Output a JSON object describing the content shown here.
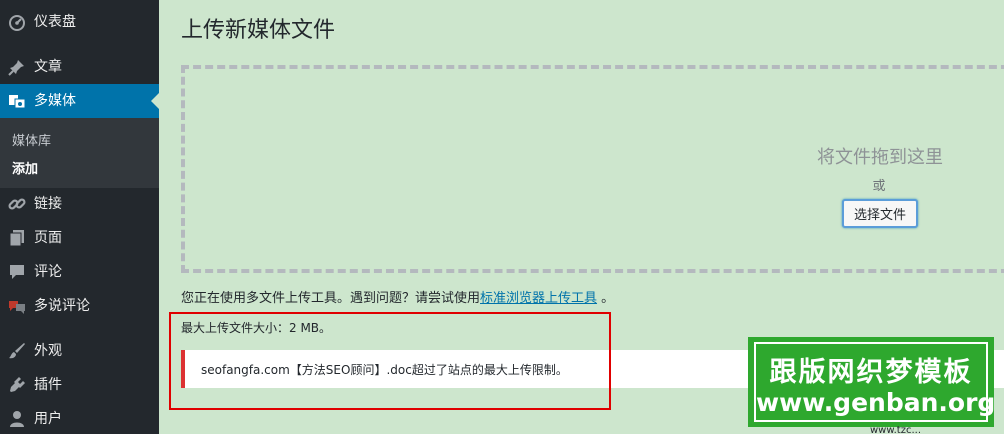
{
  "sidebar": {
    "items": [
      {
        "label": "仪表盘",
        "icon": "dashboard-icon"
      },
      {
        "label": "文章",
        "icon": "pin-icon"
      },
      {
        "label": "多媒体",
        "icon": "media-icon",
        "active": true
      },
      {
        "label": "链接",
        "icon": "link-icon"
      },
      {
        "label": "页面",
        "icon": "page-icon"
      },
      {
        "label": "评论",
        "icon": "comment-icon"
      },
      {
        "label": "多说评论",
        "icon": "duoshuo-icon"
      },
      {
        "label": "外观",
        "icon": "brush-icon"
      },
      {
        "label": "插件",
        "icon": "plugin-icon"
      },
      {
        "label": "用户",
        "icon": "user-icon"
      }
    ],
    "submenu": [
      {
        "label": "媒体库"
      },
      {
        "label": "添加",
        "current": true
      }
    ]
  },
  "main": {
    "title": "上传新媒体文件",
    "drop_info": "将文件拖到这里",
    "or": "或",
    "select_button": "选择文件",
    "notice_prefix": "您正在使用多文件上传工具。遇到问题？请尝试使用",
    "notice_link": "标准浏览器上传工具",
    "notice_suffix": " 。",
    "max_size": "最大上传文件大小：2 MB。",
    "error": "seofangfa.com【方法SEO顾问】.doc超过了站点的最大上传限制。"
  },
  "watermark": {
    "line1": "跟版网织梦模板",
    "line2": "www.genban.org",
    "tail": "www.tzc..."
  },
  "colors": {
    "sidebar_bg": "#23282d",
    "active_bg": "#0073aa",
    "page_bg": "#cde6cd",
    "error_border": "#dc3232",
    "watermark_bg": "#2ea82e"
  }
}
